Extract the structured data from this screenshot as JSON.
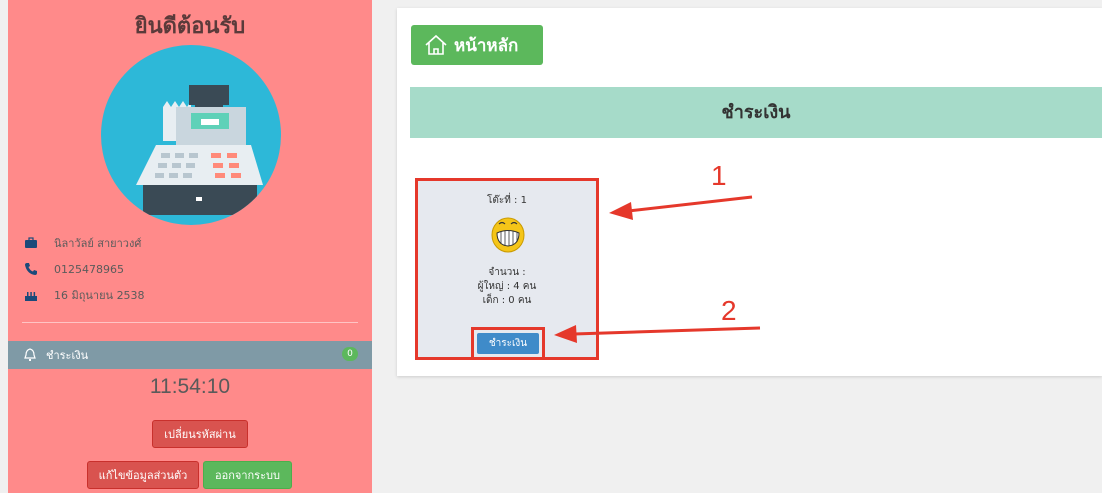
{
  "sidebar": {
    "welcome": "ยินดีต้อนรับ",
    "user_name": "นิลาวัลย์ สายาวงศ์",
    "phone": "0125478965",
    "birthday": "16 มิถุนายน 2538",
    "menu_label": "ชำระเงิน",
    "menu_badge": "0",
    "clock": "11:54:10",
    "change_password_label": "เปลี่ยนรหัสผ่าน",
    "edit_profile_label": "แก้ไขข้อมูลส่วนตัว",
    "logout_label": "ออกจากระบบ"
  },
  "main": {
    "home_label": "หน้าหลัก",
    "page_title": "ชำระเงิน",
    "table_card": {
      "table_label": "โต๊ะที่ : 1",
      "amount_label": "จำนวน :",
      "adults_label": "ผู้ใหญ่ : 4 คน",
      "children_label": "เด็ก : 0 คน",
      "pay_button_label": "ชำระเงิน"
    }
  },
  "annotations": {
    "marker_1": "1",
    "marker_2": "2"
  },
  "colors": {
    "sidebar_bg": "#ff8a8a",
    "avatar_bg": "#2db8d8",
    "menu_bar": "#7f9aa6",
    "title_bar": "#a6dbc9",
    "home_button": "#5cb85c",
    "pay_button": "#3f8bc9",
    "annotation_red": "#e5382b"
  },
  "icons": {
    "home": "home-icon",
    "briefcase": "briefcase-icon",
    "phone": "phone-icon",
    "cake": "birthday-cake-icon",
    "bell": "bell-icon",
    "cash_register": "cash-register-icon",
    "smiley": "grinning-face-icon"
  }
}
